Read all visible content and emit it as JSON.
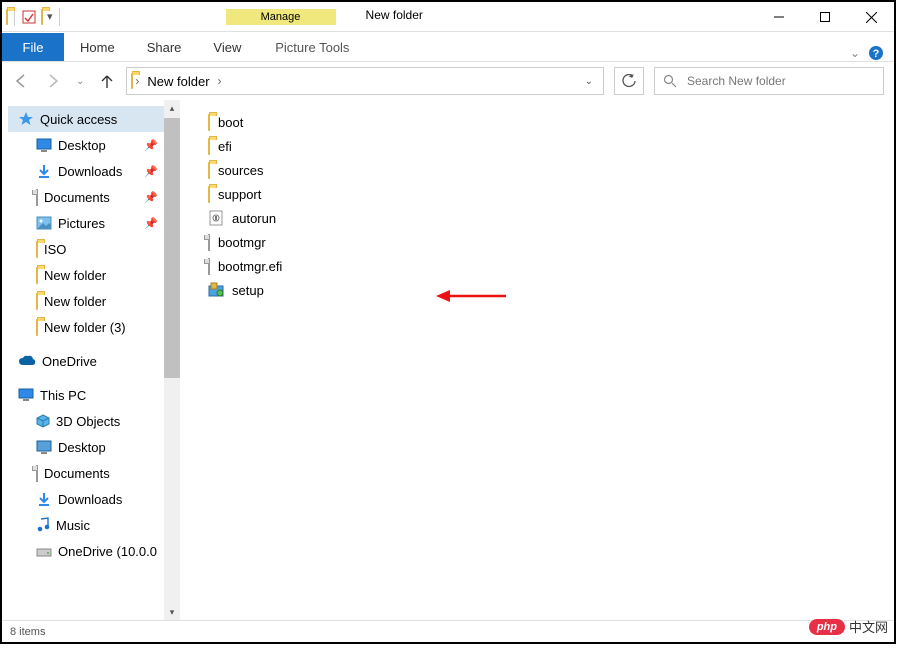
{
  "window": {
    "title": "New folder",
    "context_group": "Manage",
    "context_tab": "Picture Tools"
  },
  "ribbon": {
    "file": "File",
    "tabs": [
      "Home",
      "Share",
      "View"
    ]
  },
  "breadcrumb": {
    "segments": [
      "New folder"
    ]
  },
  "search": {
    "placeholder": "Search New folder"
  },
  "sidebar": {
    "quick_access": "Quick access",
    "pinned": [
      {
        "label": "Desktop"
      },
      {
        "label": "Downloads"
      },
      {
        "label": "Documents"
      },
      {
        "label": "Pictures"
      }
    ],
    "recent": [
      {
        "label": "ISO"
      },
      {
        "label": "New folder"
      },
      {
        "label": "New folder"
      },
      {
        "label": "New folder (3)"
      }
    ],
    "onedrive": "OneDrive",
    "this_pc": "This PC",
    "pc_items": [
      {
        "label": "3D Objects"
      },
      {
        "label": "Desktop"
      },
      {
        "label": "Documents"
      },
      {
        "label": "Downloads"
      },
      {
        "label": "Music"
      },
      {
        "label": "OneDrive (10.0.0"
      }
    ]
  },
  "files": [
    {
      "name": "boot",
      "type": "folder"
    },
    {
      "name": "efi",
      "type": "folder"
    },
    {
      "name": "sources",
      "type": "folder"
    },
    {
      "name": "support",
      "type": "folder"
    },
    {
      "name": "autorun",
      "type": "inf"
    },
    {
      "name": "bootmgr",
      "type": "file"
    },
    {
      "name": "bootmgr.efi",
      "type": "file"
    },
    {
      "name": "setup",
      "type": "exe"
    }
  ],
  "status": {
    "items_text": "8 items"
  },
  "watermark": {
    "badge": "php",
    "text": "中文网"
  }
}
